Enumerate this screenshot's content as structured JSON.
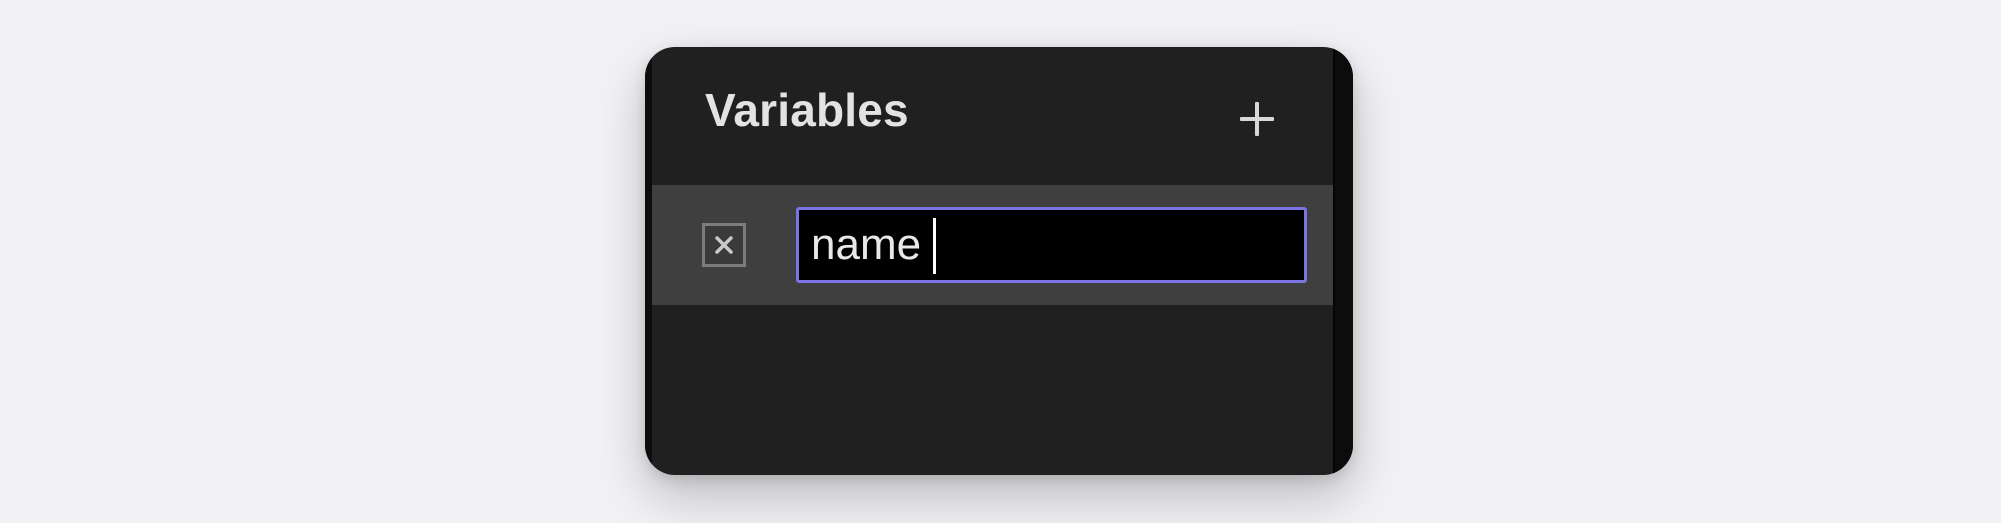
{
  "panel": {
    "title": "Variables",
    "add_icon": "plus-icon"
  },
  "variables": [
    {
      "delete_icon": "close-box-icon",
      "name": "name",
      "focused": true
    }
  ],
  "colors": {
    "background": "#f2f2f6",
    "panel": "#202020",
    "row_selected": "#3f3f3f",
    "input_background": "#000000",
    "focus_ring": "#7b75e3",
    "text": "#e3e3e3"
  }
}
